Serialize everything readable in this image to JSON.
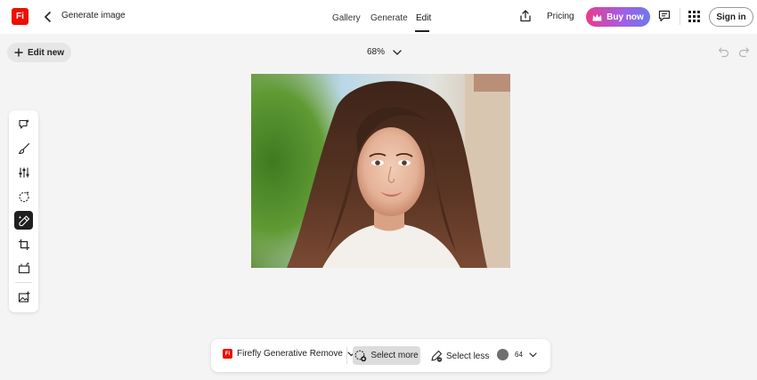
{
  "app": {
    "logo_text": "Fi",
    "brand_color": "#eb1000"
  },
  "header": {
    "title": "Generate image",
    "tabs": [
      {
        "label": "Gallery"
      },
      {
        "label": "Generate"
      },
      {
        "label": "Edit",
        "active": true
      }
    ],
    "pricing_label": "Pricing",
    "buy_label": "Buy now",
    "signin_label": "Sign in"
  },
  "toolbar_row": {
    "edit_new_label": "Edit new",
    "zoom_label": "68%"
  },
  "left_tools": [
    {
      "icon": "generative-fill-icon"
    },
    {
      "icon": "brush-icon"
    },
    {
      "icon": "adjust-icon"
    },
    {
      "icon": "effects-icon"
    },
    {
      "icon": "remove-icon",
      "active": true
    },
    {
      "icon": "crop-icon"
    },
    {
      "icon": "expand-icon"
    },
    {
      "icon": "add-image-icon"
    }
  ],
  "action_bar": {
    "model_label": "Firefly Generative Remove",
    "select_more_label": "Select more",
    "select_less_label": "Select less",
    "brush_size": "64"
  },
  "colors": {
    "active_tool": "#1f1f1f",
    "buy_gradient_start": "#e83c8a",
    "buy_gradient_end": "#6b79f0"
  }
}
